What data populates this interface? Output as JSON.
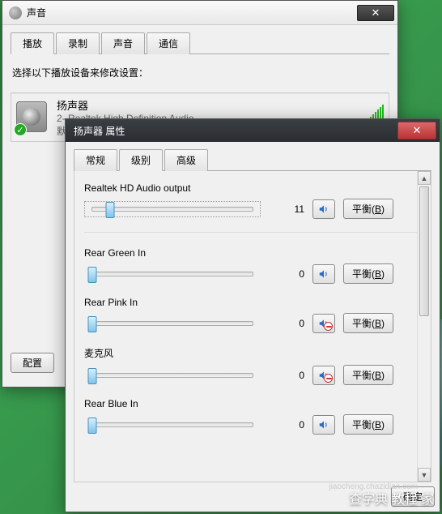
{
  "win1": {
    "title": "声音",
    "tabs": [
      "播放",
      "录制",
      "声音",
      "通信"
    ],
    "active_tab": 0,
    "instruction": "选择以下播放设备来修改设置：",
    "device": {
      "name": "扬声器",
      "sub": "2- Realtek High Definition Audio",
      "status": "默认设备"
    },
    "config_btn": "配置"
  },
  "win2": {
    "title": "扬声器 属性",
    "tabs": [
      "常规",
      "级别",
      "高级"
    ],
    "active_tab": 1,
    "balance_label": "平衡",
    "balance_key": "B",
    "ok_label": "确定",
    "sliders": [
      {
        "label": "Realtek HD Audio output",
        "value": 11,
        "muted": false,
        "framed": true
      },
      {
        "label": "Rear Green In",
        "value": 0,
        "muted": false,
        "framed": false
      },
      {
        "label": "Rear Pink In",
        "value": 0,
        "muted": true,
        "framed": false
      },
      {
        "label": "麦克风",
        "value": 0,
        "muted": true,
        "framed": false
      },
      {
        "label": "Rear Blue In",
        "value": 0,
        "muted": false,
        "framed": false
      }
    ]
  },
  "watermark": "查字典 教程 家",
  "watermark_url": "jiaocheng.chazidian.com"
}
